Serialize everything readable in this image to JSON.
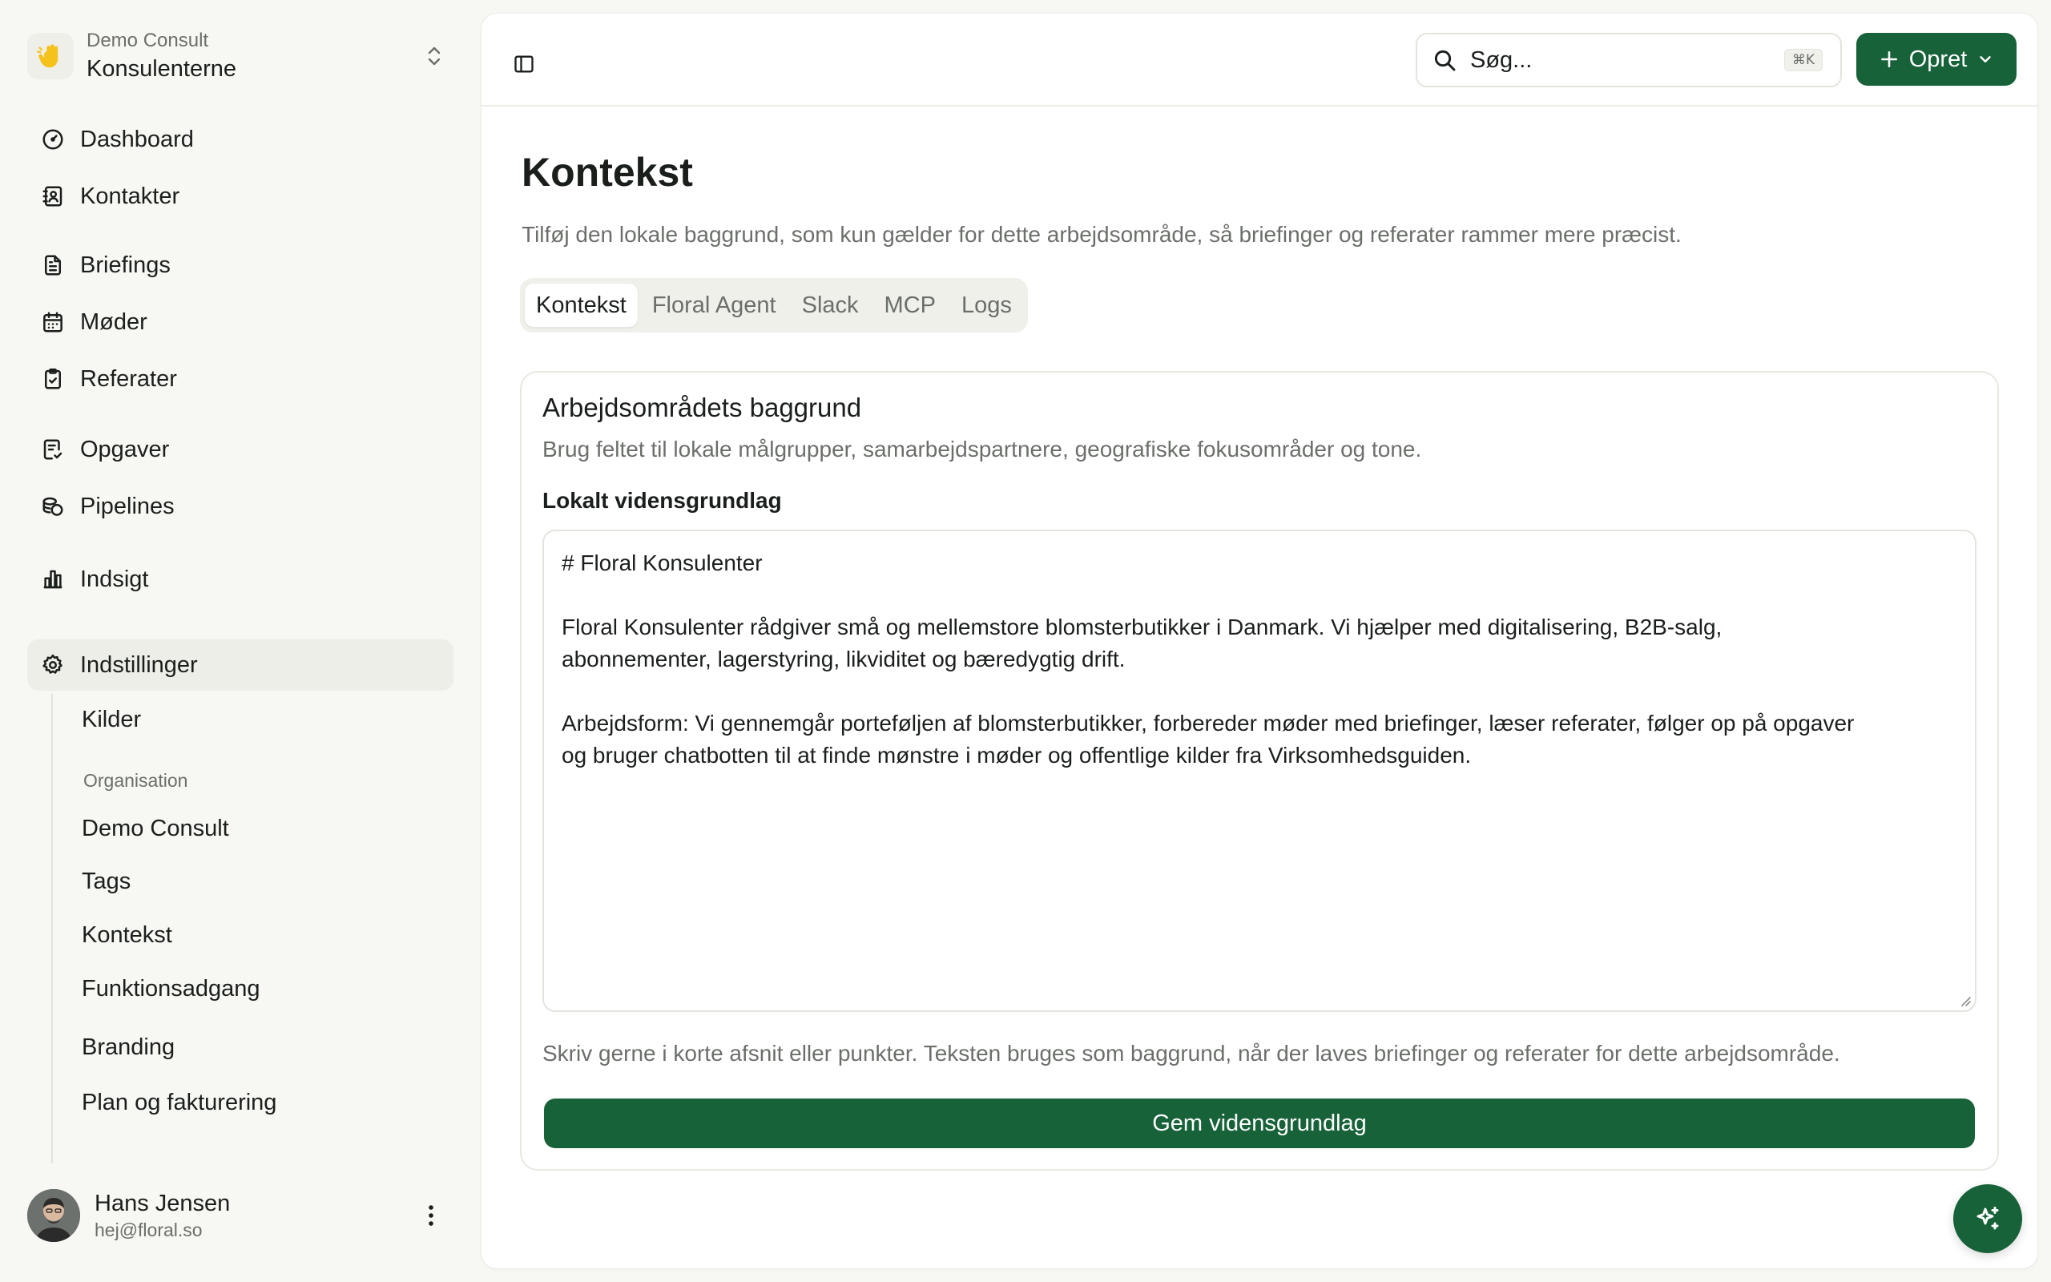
{
  "workspace": {
    "org": "Demo Consult",
    "name": "Konsulenterne",
    "logo_icon": "hand-wave-icon",
    "logo_color": "#f4c21a"
  },
  "nav": {
    "dashboard": "Dashboard",
    "kontakter": "Kontakter",
    "briefings": "Briefings",
    "moder": "Møder",
    "referater": "Referater",
    "opgaver": "Opgaver",
    "pipelines": "Pipelines",
    "indsigt": "Indsigt",
    "indstillinger": "Indstillinger"
  },
  "subnav": {
    "kilder": "Kilder",
    "group_org": "Organisation",
    "demo_consult": "Demo Consult",
    "tags": "Tags",
    "kontekst": "Kontekst",
    "funktionsadgang": "Funktionsadgang",
    "branding": "Branding",
    "plan": "Plan og fakturering"
  },
  "user": {
    "name": "Hans Jensen",
    "email": "hej@floral.so"
  },
  "topbar": {
    "search_placeholder": "Søg...",
    "search_shortcut": "⌘K",
    "create_label": "Opret"
  },
  "page": {
    "title": "Kontekst",
    "subtitle": "Tilføj den lokale baggrund, som kun gælder for dette arbejdsområde, så briefinger og referater rammer mere præcist."
  },
  "tabs": [
    "Kontekst",
    "Floral Agent",
    "Slack",
    "MCP",
    "Logs"
  ],
  "card": {
    "title": "Arbejdsområdets baggrund",
    "description": "Brug feltet til lokale målgrupper, samarbejdspartnere, geografiske fokusområder og tone.",
    "field_label": "Lokalt vidensgrundlag",
    "content": {
      "heading": "# Floral Konsulenter",
      "para1_line1": "Floral Konsulenter rådgiver små og mellemstore blomsterbutikker i Danmark. Vi hjælper med digitalisering, B2B-salg,",
      "para1_line2": "abonnementer, lagerstyring, likviditet og bæredygtig drift.",
      "para2_line1": "Arbejdsform: Vi gennemgår porteføljen af blomsterbutikker, forbereder møder med briefinger, læser referater, følger op på opgaver",
      "para2_line2": "og bruger chatbotten til at finde mønstre i møder og offentlige kilder fra Virksomhedsguiden."
    },
    "hint": "Skriv gerne i korte afsnit eller punkter. Teksten bruges som baggrund, når der laves briefinger og referater for dette arbejdsområde.",
    "save_label": "Gem vidensgrundlag"
  },
  "colors": {
    "brand_green": "#176238",
    "muted_text": "#6b6f6a"
  }
}
